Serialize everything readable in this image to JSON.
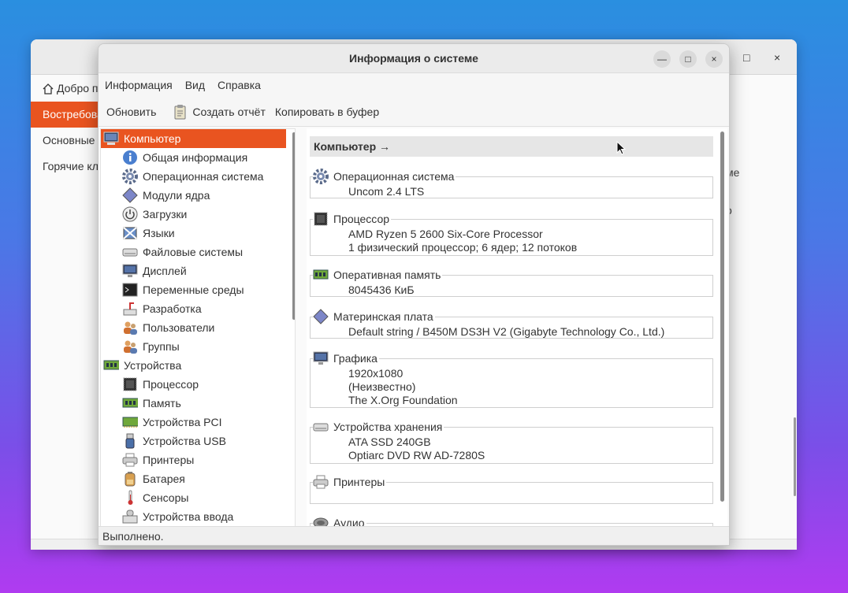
{
  "bg_window": {
    "sidebar": [
      "Добро пожаловать",
      "Востребованные",
      "Основные",
      "Горячие клавиши"
    ],
    "right_text": [
      "ме",
      "о"
    ],
    "controls": [
      "—",
      "□",
      "×"
    ]
  },
  "window": {
    "title": "Информация о системе",
    "controls": [
      "—",
      "□",
      "×"
    ]
  },
  "menu": [
    "Информация",
    "Вид",
    "Справка"
  ],
  "toolbar": {
    "refresh": "Обновить",
    "report": "Создать отчёт",
    "copy": "Копировать в буфер"
  },
  "tree": {
    "computer": "Компьютер",
    "computer_items": [
      "Общая информация",
      "Операционная система",
      "Модули ядра",
      "Загрузки",
      "Языки",
      "Файловые системы",
      "Дисплей",
      "Переменные среды",
      "Разработка",
      "Пользователи",
      "Группы"
    ],
    "devices": "Устройства",
    "device_items": [
      "Процессор",
      "Память",
      "Устройства PCI",
      "Устройства USB",
      "Принтеры",
      "Батарея",
      "Сенсоры",
      "Устройства ввода"
    ]
  },
  "content": {
    "header": "Компьютер →",
    "groups": [
      {
        "label": "Операционная система",
        "icon": "gear-icon",
        "lines": [
          "Uncom 2.4 LTS"
        ]
      },
      {
        "label": "Процессор",
        "icon": "cpu-icon",
        "lines": [
          "AMD Ryzen 5 2600 Six-Core Processor",
          "1 физический процессор; 6 ядер; 12 потоков"
        ]
      },
      {
        "label": "Оперативная память",
        "icon": "memory-icon",
        "lines": [
          "8045436 КиБ"
        ]
      },
      {
        "label": "Материнская плата",
        "icon": "motherboard-icon",
        "lines": [
          "Default string / B450M DS3H V2 (Gigabyte Technology Co., Ltd.)"
        ]
      },
      {
        "label": "Графика",
        "icon": "monitor-icon",
        "lines": [
          "1920x1080",
          "(Неизвестно)",
          "The X.Org Foundation"
        ]
      },
      {
        "label": "Устройства хранения",
        "icon": "drive-icon",
        "lines": [
          "ATA SSD 240GB",
          "Optiarc DVD RW AD-7280S"
        ]
      },
      {
        "label": "Принтеры",
        "icon": "printer-icon",
        "lines": []
      },
      {
        "label": "Аудио",
        "icon": "speaker-icon",
        "lines": []
      }
    ]
  },
  "status": "Выполнено.",
  "colors": {
    "accent": "#e95420"
  }
}
